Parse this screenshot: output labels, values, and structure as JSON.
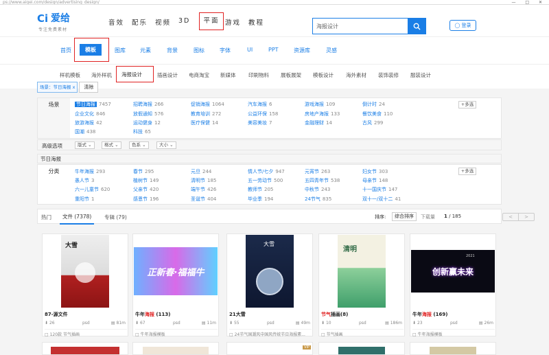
{
  "browser": {
    "url": "ps://www.aigei.com/design/advertising_design/",
    "window_controls": "— □ ✕"
  },
  "logo": {
    "mark": "Ci",
    "name": "爱给",
    "slogan": "专注免费素材"
  },
  "main_nav": [
    {
      "label": "音效",
      "active": false
    },
    {
      "label": "配乐",
      "active": false
    },
    {
      "label": "视频",
      "active": false
    },
    {
      "label": "3D",
      "active": false
    },
    {
      "label": "平面",
      "active": true
    },
    {
      "label": "游戏",
      "active": false
    },
    {
      "label": "教程",
      "active": false
    }
  ],
  "search": {
    "value": "海报设计",
    "icon": "search-icon"
  },
  "login_label": "登录",
  "sub_nav": [
    "首页",
    "模板",
    "图库",
    "元素",
    "背景",
    "图标",
    "字体",
    "UI",
    "PPT",
    "资源库",
    "灵感"
  ],
  "sub_nav_active": "模板",
  "categories": [
    "样机模板",
    "海外样机",
    "海报设计",
    "插画设计",
    "电商淘宝",
    "新媒体",
    "印刷物料",
    "展板展架",
    "模板设计",
    "海外素材",
    "装饰装修",
    "服装设计"
  ],
  "category_active": "海报设计",
  "filter_tag": "场景：节日海报 x",
  "clear_label": "清除",
  "scene": {
    "label": "场景",
    "more": "+多选",
    "options": [
      {
        "t": "节日海报",
        "n": "7457",
        "sel": true
      },
      {
        "t": "招聘海报",
        "n": "266"
      },
      {
        "t": "促销海报",
        "n": "1064"
      },
      {
        "t": "汽车海报",
        "n": "6"
      },
      {
        "t": "游戏海报",
        "n": "109"
      },
      {
        "t": "倒计时",
        "n": "24"
      },
      {
        "t": "企业文化",
        "n": "846"
      },
      {
        "t": "放假通知",
        "n": "576"
      },
      {
        "t": "教育培训",
        "n": "272"
      },
      {
        "t": "公益环保",
        "n": "158"
      },
      {
        "t": "房地产海报",
        "n": "133"
      },
      {
        "t": "餐饮美食",
        "n": "110"
      },
      {
        "t": "旅游海报",
        "n": "42"
      },
      {
        "t": "运动健身",
        "n": "12"
      },
      {
        "t": "医疗保健",
        "n": "14"
      },
      {
        "t": "美容美妆",
        "n": "7"
      },
      {
        "t": "金融理财",
        "n": "14"
      },
      {
        "t": "古风",
        "n": "299"
      },
      {
        "t": "国潮",
        "n": "438"
      },
      {
        "t": "科技",
        "n": "65"
      }
    ]
  },
  "advanced": {
    "label": "高级选项",
    "dropdowns": [
      "版式",
      "格式",
      "色系",
      "大小"
    ]
  },
  "holiday_section": {
    "title": "节日海报",
    "label": "分类",
    "more": "+多选",
    "options": [
      {
        "t": "牛年海报",
        "n": "293"
      },
      {
        "t": "春节",
        "n": "295"
      },
      {
        "t": "元旦",
        "n": "244"
      },
      {
        "t": "情人节/七夕",
        "n": "947"
      },
      {
        "t": "元宵节",
        "n": "263"
      },
      {
        "t": "妇女节",
        "n": "303"
      },
      {
        "t": "愚人节",
        "n": "3"
      },
      {
        "t": "植树节",
        "n": "149"
      },
      {
        "t": "清明节",
        "n": "185"
      },
      {
        "t": "五一劳动节",
        "n": "500"
      },
      {
        "t": "五四青年节",
        "n": "538"
      },
      {
        "t": "母亲节",
        "n": "148"
      },
      {
        "t": "六一儿童节",
        "n": "620"
      },
      {
        "t": "父亲节",
        "n": "420"
      },
      {
        "t": "端午节",
        "n": "426"
      },
      {
        "t": "教师节",
        "n": "205"
      },
      {
        "t": "中秋节",
        "n": "243"
      },
      {
        "t": "十一国庆节",
        "n": "147"
      },
      {
        "t": "重阳节",
        "n": "1"
      },
      {
        "t": "感恩节",
        "n": "196"
      },
      {
        "t": "圣诞节",
        "n": "404"
      },
      {
        "t": "毕业季",
        "n": "194"
      },
      {
        "t": "24节气",
        "n": "835"
      },
      {
        "t": "双十一/双十二",
        "n": "41"
      }
    ]
  },
  "tabs": [
    {
      "label": "热门",
      "active": false
    },
    {
      "label": "文件 (7378)",
      "active": true
    },
    {
      "label": "专辑 (79)",
      "active": false
    }
  ],
  "sort": {
    "label": "排序:",
    "selected": "综合排序",
    "alt": "下载量",
    "page": "1",
    "total": "/ 185",
    "prev": "<",
    "next": ">"
  },
  "cards": [
    {
      "title_pre": "87-源文件",
      "title_hl": "",
      "title_post": "",
      "downloads": "26",
      "format": "psd",
      "size": "81m",
      "tags": "120款 节气插画"
    },
    {
      "title_pre": "牛年",
      "title_hl": "海报",
      "title_post": " (113)",
      "downloads": "67",
      "format": "psd",
      "size": "11m",
      "tags": "牛年海报模板"
    },
    {
      "title_pre": "21大雪",
      "title_hl": "",
      "title_post": "",
      "downloads": "55",
      "format": "psd",
      "size": "49m",
      "tags": "24节气国潮风中国风传统节日海报素..."
    },
    {
      "title_pre": "节气",
      "title_hl": "插画",
      "title_post": "(8)",
      "downloads": "10",
      "format": "psd",
      "size": "186m",
      "tags": "节气插画",
      "title_hl_first": true
    },
    {
      "title_pre": "牛年",
      "title_hl": "海报",
      "title_post": " (169)",
      "downloads": "23",
      "format": "psd",
      "size": "26m",
      "tags": "牛年海报模板"
    }
  ],
  "thumb_texts": [
    "大雪",
    "正新春·福福牛",
    "大雪",
    "清明",
    "创新赢未来",
    "2021"
  ],
  "vip_label": "VIP",
  "colors": {
    "brand": "#1a7ee6",
    "highlight": "#e02020"
  }
}
